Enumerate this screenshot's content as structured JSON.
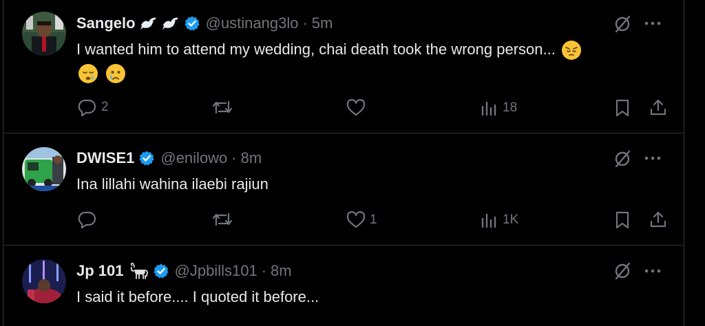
{
  "colors": {
    "background": "#000000",
    "text": "#e7e9ea",
    "muted": "#71767b",
    "verified": "#1d9bf0",
    "divider": "#2f3336"
  },
  "tweets": [
    {
      "name": "Sangelo",
      "name_emoji": [
        "dove-icon",
        "dove-icon"
      ],
      "handle": "@ustinang3lo",
      "separator": "·",
      "time": "5m",
      "text": "I wanted him to attend my wedding, chai death took the wrong person...",
      "text_emoji": [
        "pensive-face-emoji",
        "sleepy-face-emoji",
        "crying-face-emoji"
      ],
      "replies": "2",
      "retweets": "",
      "likes": "",
      "views": "18"
    },
    {
      "name": "DWISE1",
      "handle": "@enilowo",
      "separator": "·",
      "time": "8m",
      "text": "Ina lillahi wahina ilaebi rajiun",
      "replies": "",
      "retweets": "",
      "likes": "1",
      "views": "1K"
    },
    {
      "name": "Jp 101",
      "name_emoji": [
        "goat-icon"
      ],
      "handle": "@Jpbills101",
      "separator": "·",
      "time": "8m",
      "text": "I said it before.... I quoted it before..."
    }
  ]
}
